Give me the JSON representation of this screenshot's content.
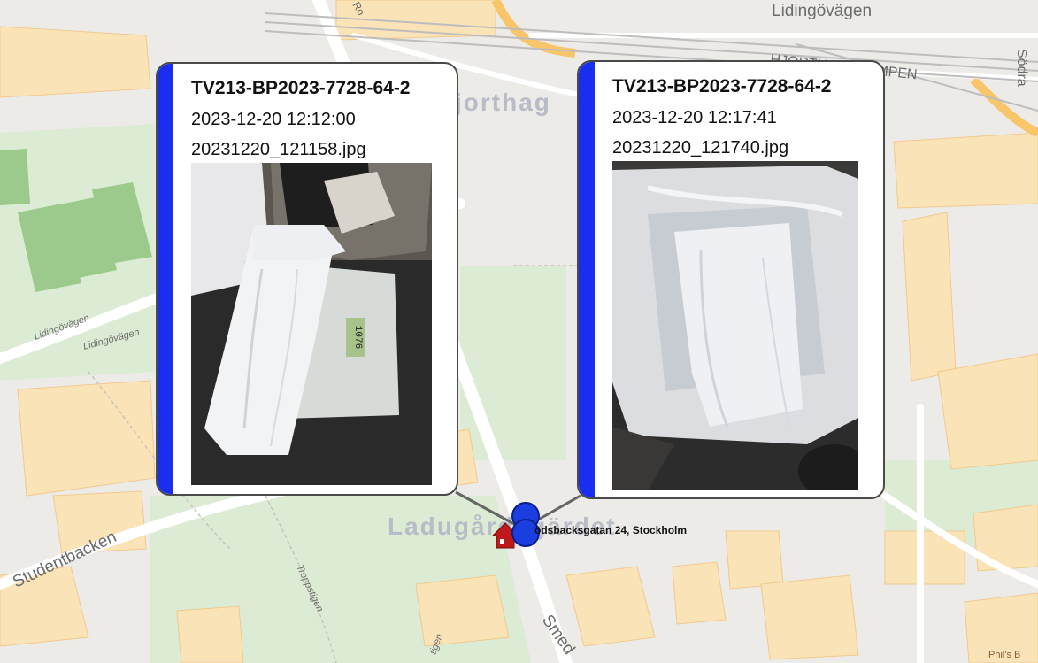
{
  "map": {
    "district": "Ladugårdsgärdet",
    "district_partial": "jorthag",
    "streets": [
      "Lidingövägen",
      "HJORTHAGSRAMPEN",
      "Studentbacken",
      "Lidingövägen",
      "Lidingövägen",
      "Troppstigen",
      "Smed",
      "Ro",
      "Södra",
      "tigen"
    ],
    "colors": {
      "building": "#fbe3b8",
      "park": "#dcebd4",
      "field": "#9bca8c",
      "water_road": "#f9c56a"
    }
  },
  "popups": [
    {
      "title": "TV213-BP2023-7728-64-2",
      "timestamp": "2023-12-20 12:12:00",
      "filename": "20231220_121158.jpg",
      "accent_color": "#1a2ef0",
      "scale_reading": "1076"
    },
    {
      "title": "TV213-BP2023-7728-64-2",
      "timestamp": "2023-12-20 12:17:41",
      "filename": "20231220_121740.jpg",
      "accent_color": "#1a2ef0"
    }
  ],
  "marker": {
    "address": "ödsbacksgatan 24, Stockholm",
    "home_icon": "house-icon",
    "pin_icon": "circle-pin-icon",
    "home_color": "#c0191b",
    "pin_color": "#1b3ee0"
  },
  "corner_label": "Phil's B"
}
